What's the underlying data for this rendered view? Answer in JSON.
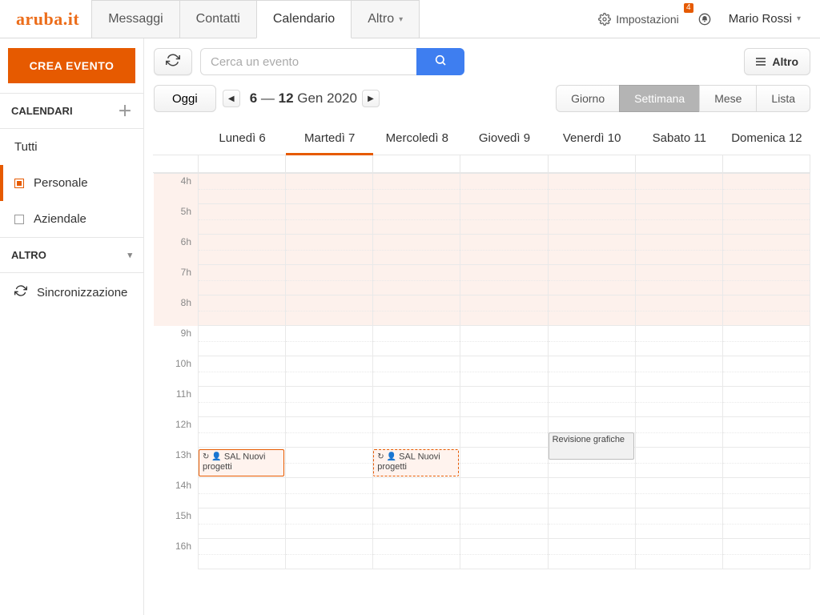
{
  "header": {
    "logo_text": "aruba.it",
    "tabs": [
      {
        "label": "Messaggi",
        "active": false
      },
      {
        "label": "Contatti",
        "active": false
      },
      {
        "label": "Calendario",
        "active": true
      },
      {
        "label": "Altro",
        "active": false,
        "dropdown": true
      }
    ],
    "settings_label": "Impostazioni",
    "notification_count": "4",
    "user_name": "Mario Rossi"
  },
  "sidebar": {
    "create_label": "CREA EVENTO",
    "section_calendars": "CALENDARI",
    "cal_all": "Tutti",
    "calendars": [
      {
        "label": "Personale",
        "color": "orange",
        "active": true
      },
      {
        "label": "Aziendale",
        "color": "gray",
        "active": false
      }
    ],
    "section_other": "ALTRO",
    "sync_label": "Sincronizzazione"
  },
  "toolbar": {
    "search_placeholder": "Cerca un evento",
    "altro_label": "Altro"
  },
  "nav": {
    "today_label": "Oggi",
    "range_strong_a": "6",
    "range_sep": " — ",
    "range_strong_b": "12",
    "range_tail": " Gen 2020",
    "views": [
      {
        "label": "Giorno",
        "active": false
      },
      {
        "label": "Settimana",
        "active": true
      },
      {
        "label": "Mese",
        "active": false
      },
      {
        "label": "Lista",
        "active": false
      }
    ]
  },
  "calendar": {
    "days": [
      {
        "label": "Lunedì 6"
      },
      {
        "label": "Martedì 7",
        "today": true
      },
      {
        "label": "Mercoledì 8"
      },
      {
        "label": "Giovedì 9"
      },
      {
        "label": "Venerdì 10"
      },
      {
        "label": "Sabato 11"
      },
      {
        "label": "Domenica 12"
      }
    ],
    "hours": [
      "4h",
      "5h",
      "6h",
      "7h",
      "8h",
      "9h",
      "10h",
      "11h",
      "12h",
      "13h",
      "14h",
      "15h",
      "16h"
    ],
    "out_of_bounds_until_index": 5,
    "events": [
      {
        "title": "SAL Nuovi progetti",
        "day": 0,
        "hour_index": 9,
        "span_halves": 2,
        "style": "primary",
        "recurring": true,
        "attendees": true
      },
      {
        "title": "SAL Nuovi progetti",
        "day": 2,
        "hour_index": 9,
        "span_halves": 2,
        "style": "primary dashed",
        "recurring": true,
        "attendees": true
      },
      {
        "title": "Revisione grafiche",
        "day": 4,
        "hour_index": 8,
        "span_halves": 2,
        "style": "gray",
        "recurring": false,
        "attendees": false,
        "half_offset": true
      }
    ]
  }
}
